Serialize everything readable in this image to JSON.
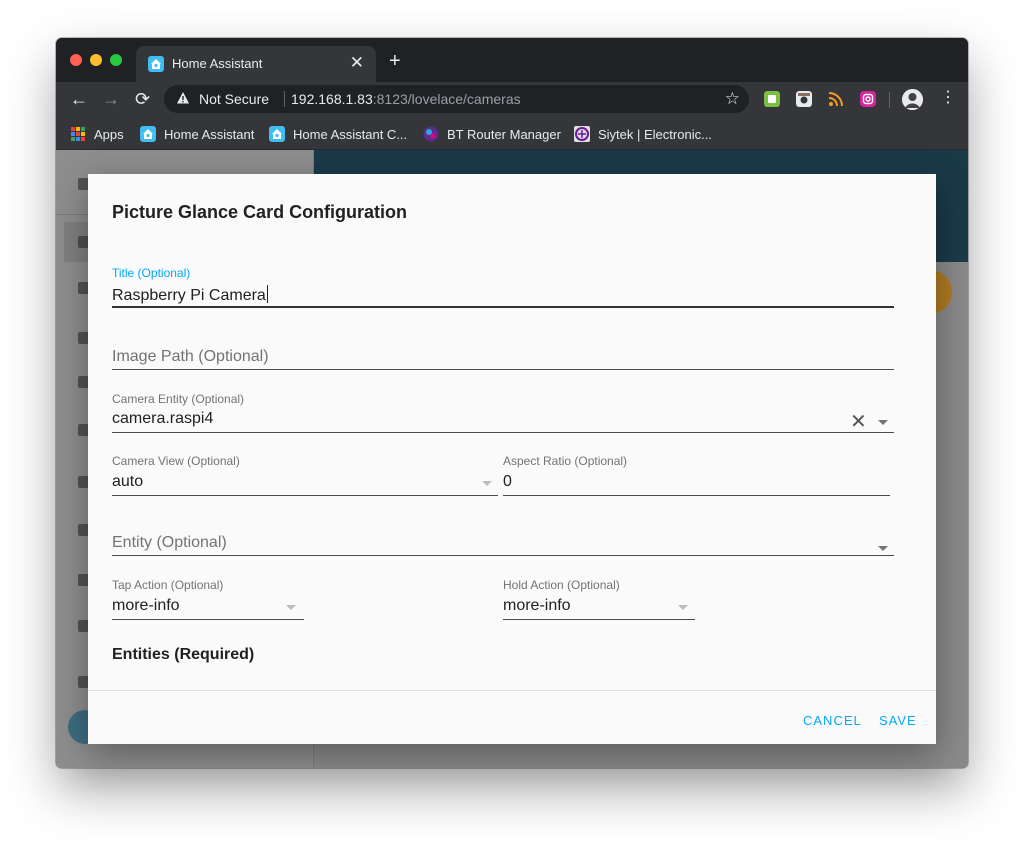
{
  "browser": {
    "tab": {
      "title": "Home Assistant",
      "close_glyph": "✕"
    },
    "new_tab_glyph": "+",
    "nav": {
      "back_glyph": "←",
      "forward_glyph": "→",
      "reload_glyph": "⟳"
    },
    "address_bar": {
      "security_text": "Not Secure",
      "url_host": "192.168.1.83",
      "url_rest": ":8123/lovelace/cameras",
      "star_glyph": "☆"
    },
    "menu_glyph": "⋮",
    "bookmarks": [
      {
        "label": "Apps",
        "icon": "apps-grid-icon"
      },
      {
        "label": "Home Assistant",
        "icon": "home-assistant-icon"
      },
      {
        "label": "Home Assistant C...",
        "icon": "home-assistant-icon"
      },
      {
        "label": "BT Router Manager",
        "icon": "bt-router-icon"
      },
      {
        "label": "Siytek | Electronic...",
        "icon": "siytek-icon"
      }
    ],
    "colors": {
      "chrome_dark": "#202124",
      "chrome": "#35363a",
      "accent": "#03a9f4"
    }
  },
  "dialog": {
    "title": "Picture Glance Card Configuration",
    "fields": {
      "title": {
        "label": "Title (Optional)",
        "value": "Raspberry Pi Camera"
      },
      "image_path": {
        "placeholder": "Image Path (Optional)"
      },
      "camera_entity": {
        "label": "Camera Entity (Optional)",
        "value": "camera.raspi4",
        "clear_glyph": "✕"
      },
      "camera_view": {
        "label": "Camera View (Optional)",
        "value": "auto"
      },
      "aspect_ratio": {
        "label": "Aspect Ratio (Optional)",
        "value": "0"
      },
      "entity": {
        "placeholder": "Entity (Optional)"
      },
      "tap_action": {
        "label": "Tap Action (Optional)",
        "value": "more-info"
      },
      "hold_action": {
        "label": "Hold Action (Optional)",
        "value": "more-info"
      }
    },
    "entities_section_title": "Entities (Required)",
    "buttons": {
      "cancel": "CANCEL",
      "save": "SAVE"
    }
  }
}
